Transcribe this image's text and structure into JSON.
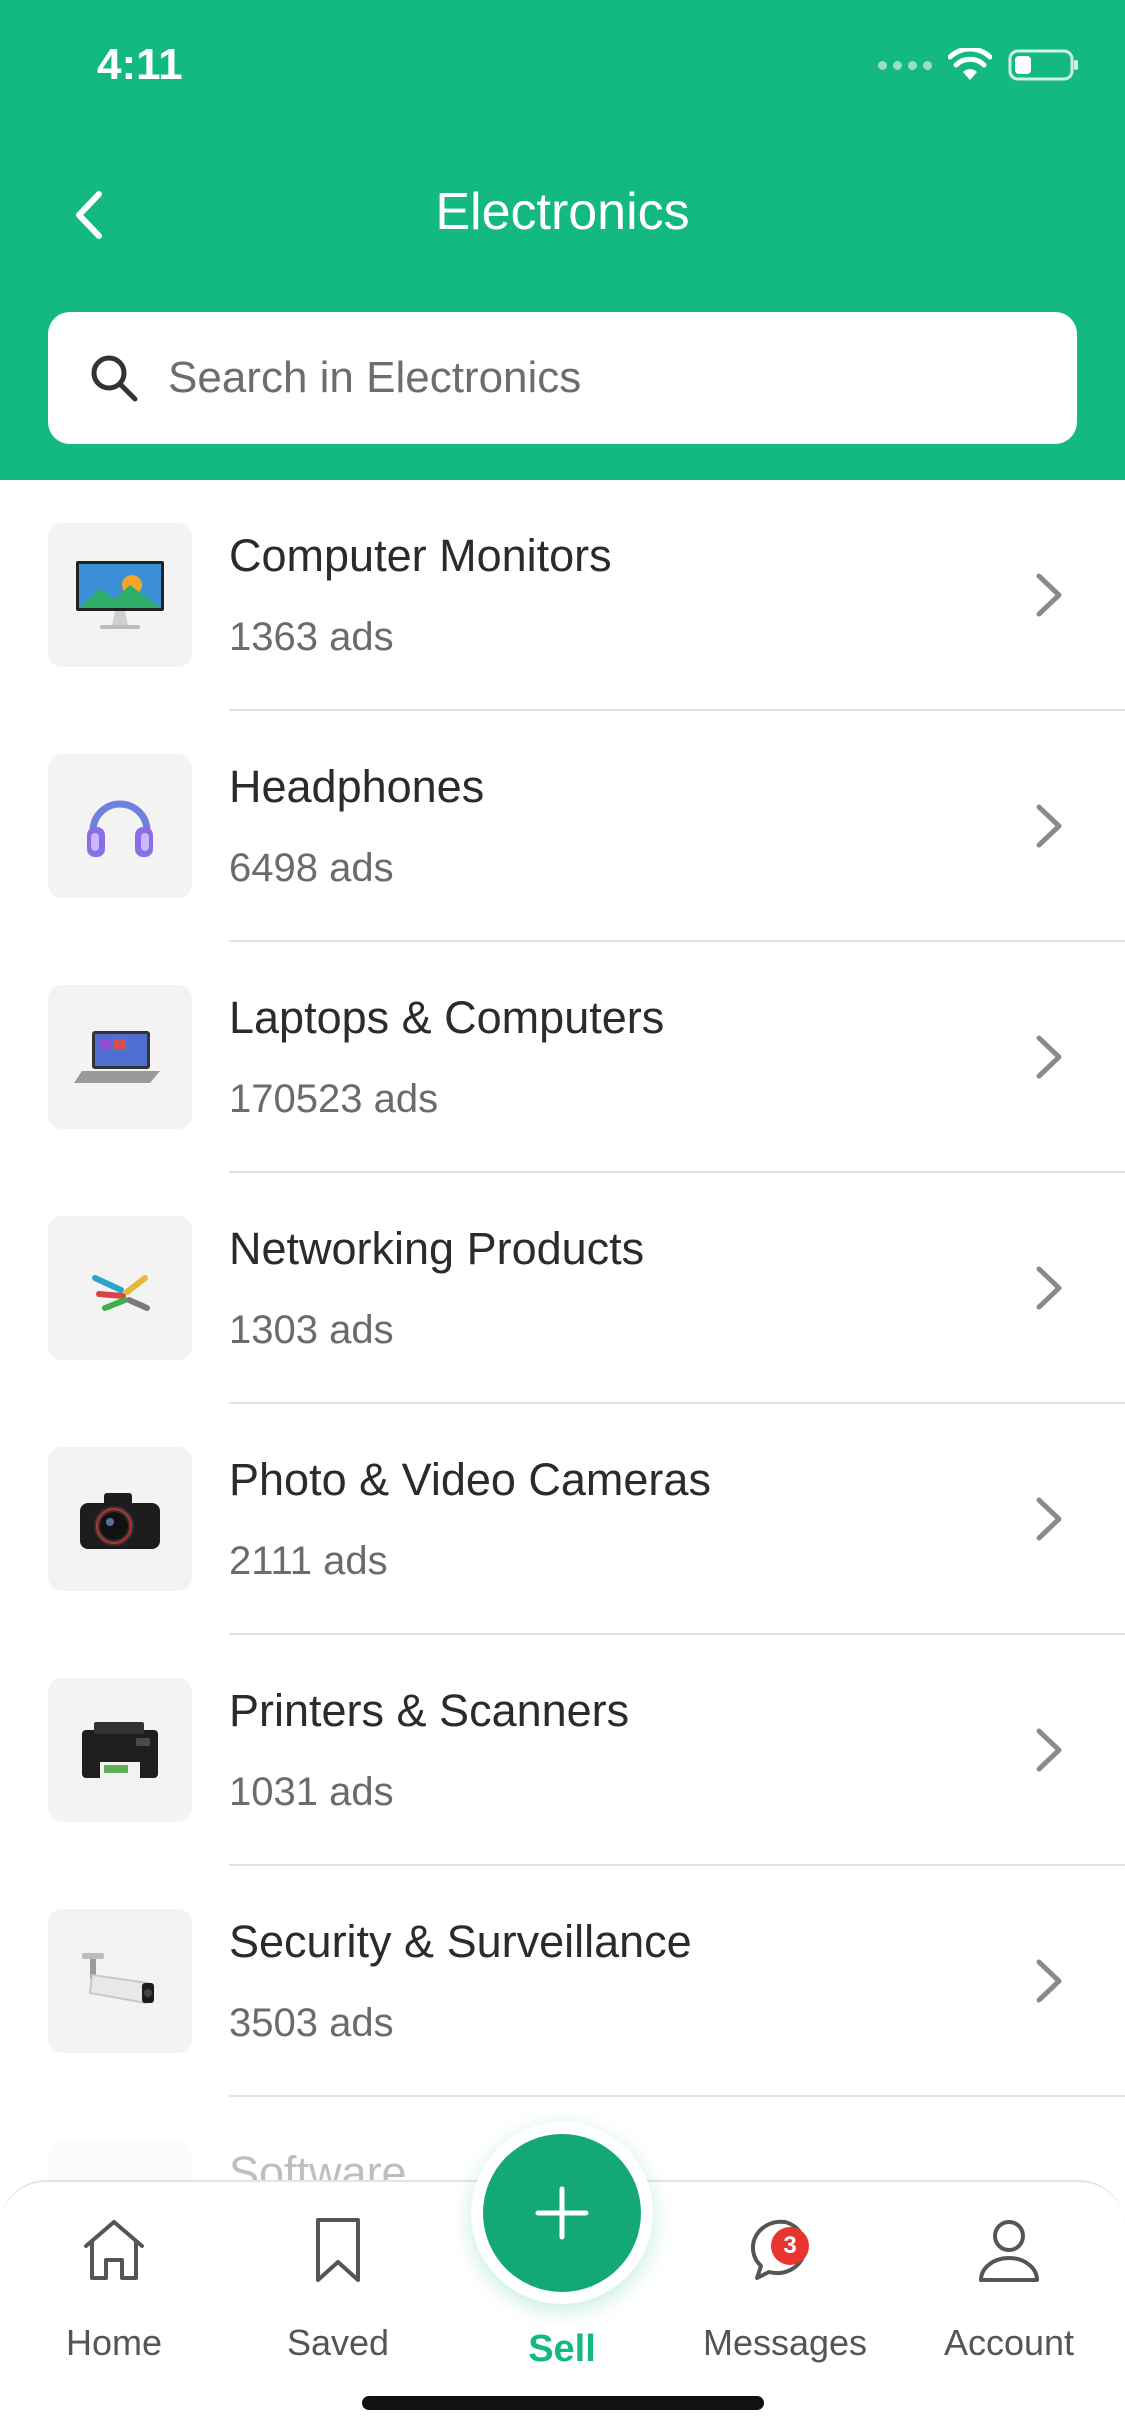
{
  "status_bar": {
    "time": "4:11"
  },
  "header": {
    "title": "Electronics"
  },
  "search": {
    "placeholder": "Search in Electronics"
  },
  "categories": [
    {
      "name": "Computer Monitors",
      "count": "1363 ads",
      "icon": "monitor-icon"
    },
    {
      "name": "Headphones",
      "count": "6498 ads",
      "icon": "headphones-icon"
    },
    {
      "name": "Laptops & Computers",
      "count": "170523 ads",
      "icon": "laptop-icon"
    },
    {
      "name": "Networking Products",
      "count": "1303 ads",
      "icon": "network-cable-icon"
    },
    {
      "name": "Photo & Video Cameras",
      "count": "2111 ads",
      "icon": "camera-icon"
    },
    {
      "name": "Printers & Scanners",
      "count": "1031 ads",
      "icon": "printer-icon"
    },
    {
      "name": "Security & Surveillance",
      "count": "3503 ads",
      "icon": "cctv-camera-icon"
    },
    {
      "name": "Software",
      "count": "",
      "icon": "software-icon"
    }
  ],
  "tabbar": {
    "home": "Home",
    "saved": "Saved",
    "sell": "Sell",
    "messages": "Messages",
    "messages_badge": "3",
    "account": "Account"
  },
  "colors": {
    "brand": "#14b883",
    "badge": "#e8352f"
  }
}
